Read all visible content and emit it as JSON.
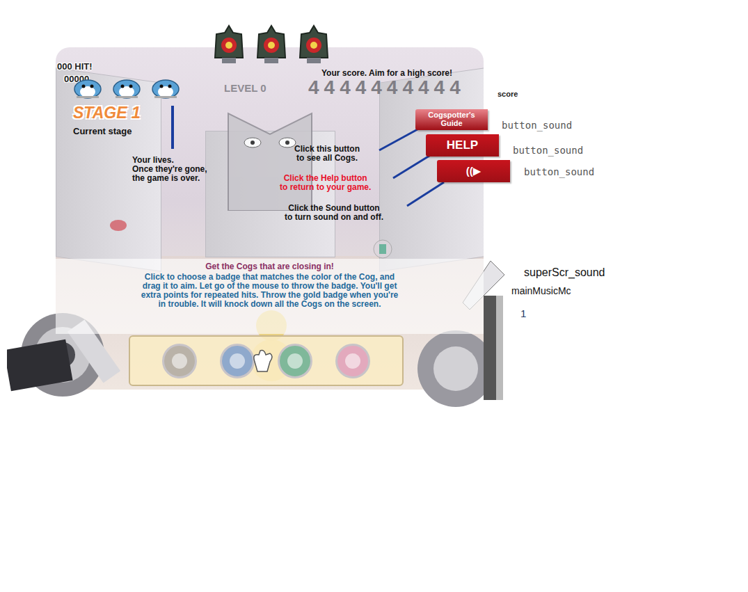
{
  "hud": {
    "hits": "000 HIT!",
    "hit_points": "00000",
    "level": "LEVEL 0",
    "score_caption": "Your score. Aim for a high score!",
    "score": "4444444444",
    "stage": "STAGE 1",
    "stage_caption": "Current stage",
    "lives": [
      {
        "alive": true
      },
      {
        "alive": true
      },
      {
        "alive": true
      }
    ]
  },
  "score_label": "score",
  "lives_help": {
    "lines": [
      "Your lives.",
      "Once they're gone,",
      "the game is over."
    ]
  },
  "buttons": [
    {
      "label": "Cogspotter's Guide",
      "tag": "button_sound",
      "help": [
        "Click this button",
        "to see all Cogs."
      ],
      "help_color": "#111111"
    },
    {
      "label": "HELP",
      "tag": "button_sound",
      "help": [
        "Click the Help button",
        "to return to your game."
      ],
      "help_color": "#e8102a"
    },
    {
      "label": "((▶",
      "tag": "button_sound",
      "help": [
        "Click the Sound button",
        "to turn sound on and off."
      ],
      "help_color": "#111111"
    }
  ],
  "instructions": {
    "title": "Get the Cogs that are closing in!",
    "lines": [
      "Click to choose a badge that matches the color of the Cog, and",
      "drag it to aim. Let go of the mouse to throw the badge. You'll get",
      "extra points for repeated hits. Throw the gold badge when you're",
      "in trouble. It will knock down all the Cogs on the screen."
    ]
  },
  "badges": [
    {
      "color": "#b9b2a8"
    },
    {
      "color": "#8fa9cc"
    },
    {
      "color": "#7fb89a"
    },
    {
      "color": "#e3a9bd"
    }
  ],
  "debug_labels": [
    "superScr_sound",
    "mainMusicMc",
    "1"
  ]
}
